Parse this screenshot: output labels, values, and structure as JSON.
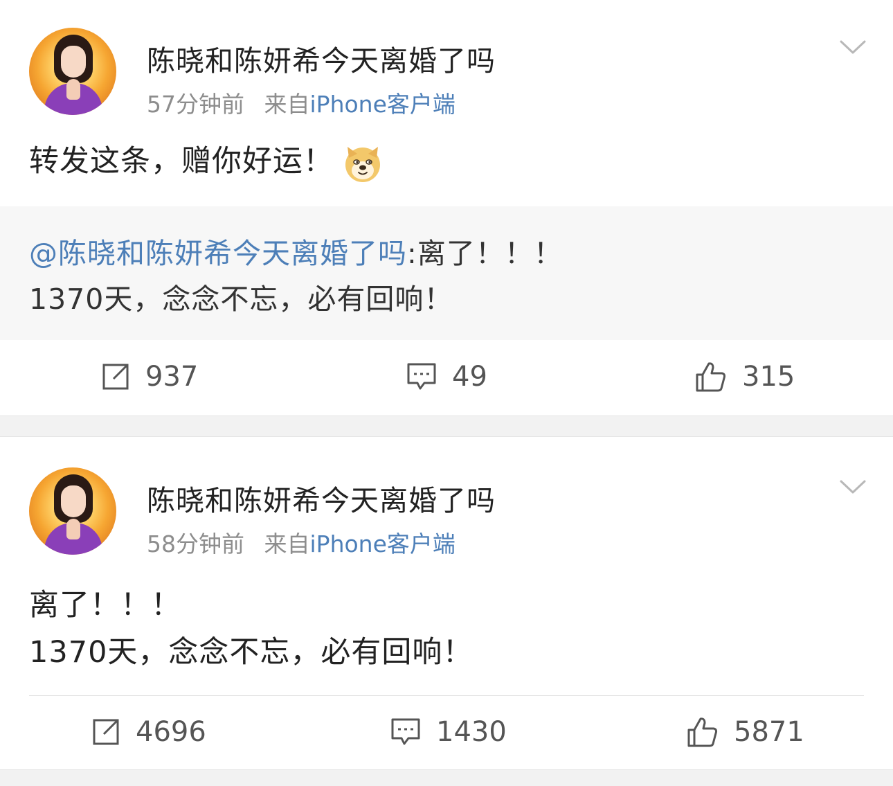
{
  "posts": [
    {
      "username": "陈晓和陈妍希今天离婚了吗",
      "time": "57分钟前",
      "from_prefix": "来自",
      "source": "iPhone客户端",
      "text": "转发这条，赠你好运！",
      "emoji_icon": "doge-emoji-icon",
      "quote": {
        "mention": "@陈晓和陈妍希今天离婚了吗",
        "line1_rest": ":离了！！！",
        "line2": "1370天，念念不忘，必有回响！"
      },
      "reposts": "937",
      "comments": "49",
      "likes": "315"
    },
    {
      "username": "陈晓和陈妍希今天离婚了吗",
      "time": "58分钟前",
      "from_prefix": "来自",
      "source": "iPhone客户端",
      "text_line1": "离了！！！",
      "text_line2": "1370天，念念不忘，必有回响！",
      "reposts": "4696",
      "comments": "1430",
      "likes": "5871"
    }
  ],
  "colors": {
    "link": "#4d7fb8",
    "meta": "#8d8d8d",
    "quote_bg": "#f7f7f7",
    "gap_bg": "#f2f2f2"
  }
}
